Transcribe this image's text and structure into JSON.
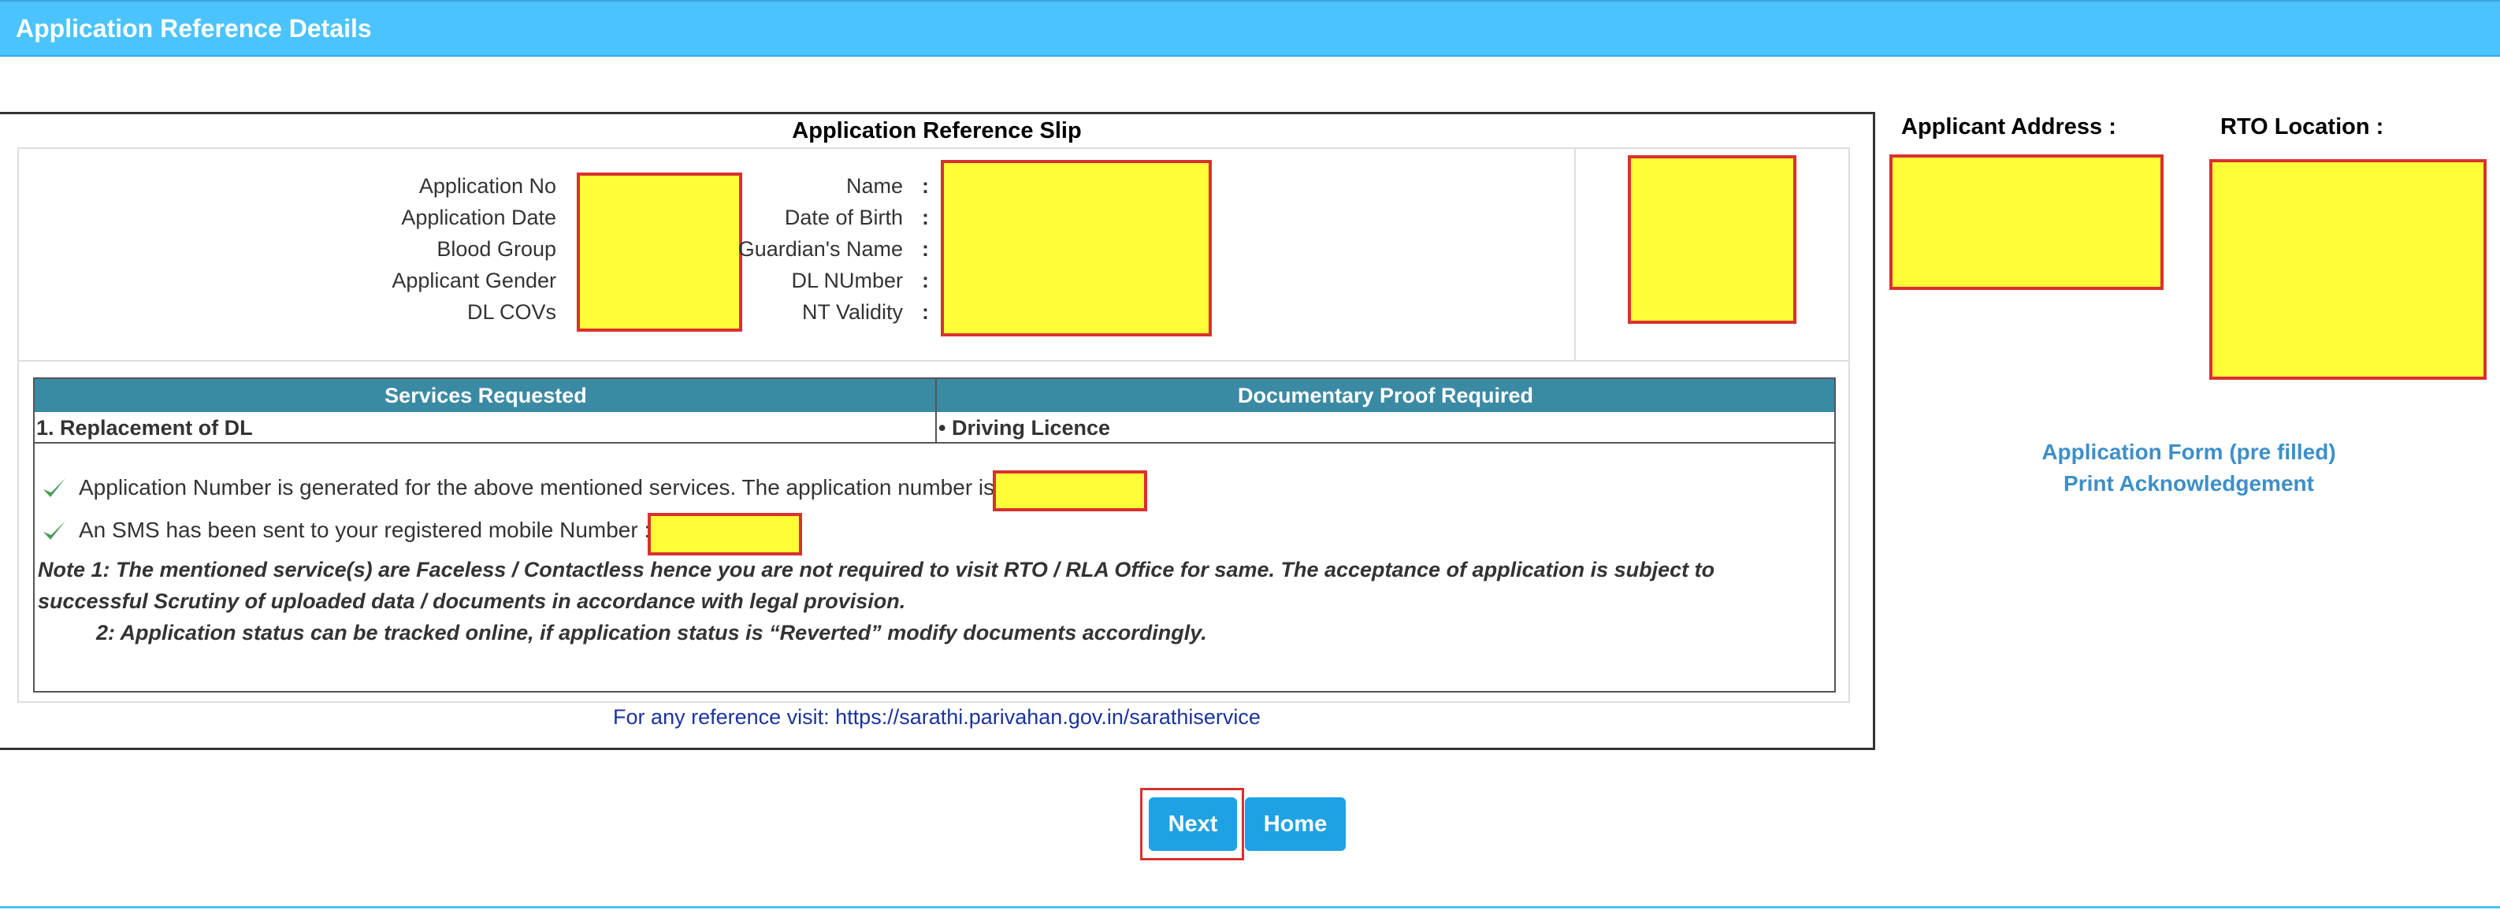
{
  "header": {
    "title": "Application Reference Details"
  },
  "slip": {
    "title": "Application Reference Slip",
    "left_fields": [
      "Application No",
      "Application Date",
      "Blood Group",
      "Applicant Gender",
      "DL COVs"
    ],
    "right_fields": [
      "Name",
      "Date of Birth",
      "Guardian's Name",
      "DL NUmber",
      "NT Validity"
    ],
    "colon": ":",
    "services_table": {
      "headers": [
        "Services Requested",
        "Documentary Proof Required"
      ],
      "rows": [
        [
          "1. Replacement of DL",
          "• Driving Licence"
        ]
      ]
    },
    "messages": {
      "app_number": "Application Number is generated for the above mentioned services. The application number is:",
      "sms": "An SMS has been sent to your registered mobile Number :"
    },
    "notes": {
      "note1": "Note 1:  The mentioned service(s) are Faceless / Contactless hence you are not required to visit RTO / RLA Office for same. The acceptance of application is subject to successful Scrutiny of uploaded data / documents in accordance with legal provision.",
      "note2": "2:  Application status can be tracked online, if application status is “Reverted” modify documents accordingly."
    },
    "reference": {
      "prefix": "For any reference visit: ",
      "url": "https://sarathi.parivahan.gov.in/sarathiservice"
    }
  },
  "side": {
    "address_label": "Applicant Address :",
    "rto_label": "RTO Location :",
    "links": [
      "Application Form (pre filled)",
      "Print Acknowledgement"
    ]
  },
  "buttons": {
    "next": "Next",
    "home": "Home"
  },
  "colors": {
    "header": "#4bc3fd",
    "table_header": "#3b8aa3",
    "button": "#1ea2e3",
    "redaction": "#fdfd38",
    "redaction_border": "#d9312f",
    "link": "#3d8fc9"
  }
}
